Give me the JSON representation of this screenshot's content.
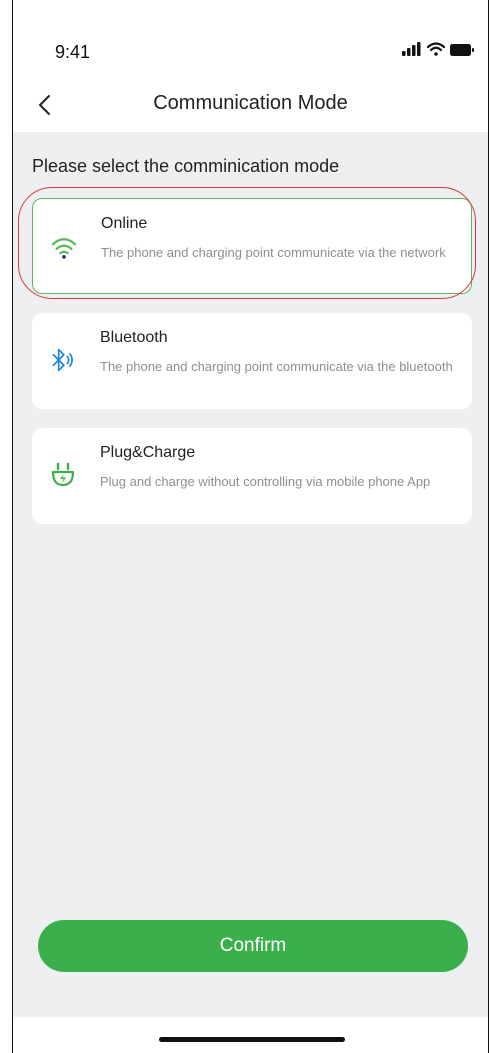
{
  "status_bar": {
    "time": "9:41"
  },
  "nav": {
    "title": "Communication Mode"
  },
  "section": {
    "label": "Please select the comminication mode"
  },
  "options": [
    {
      "title": "Online",
      "description": "The phone and charging point communicate via the network",
      "icon": "wifi-icon",
      "selected": true,
      "accent": "#5cb85c"
    },
    {
      "title": "Bluetooth",
      "description": "The phone and charging point communicate via the bluetooth",
      "icon": "bluetooth-icon",
      "selected": false,
      "accent": "#1e88e5"
    },
    {
      "title": "Plug&Charge",
      "description": "Plug and charge without controlling via mobile phone App",
      "icon": "plug-charge-icon",
      "selected": false,
      "accent": "#3aaf4b"
    }
  ],
  "confirm": {
    "label": "Confirm"
  },
  "colors": {
    "primary_green": "#3aaf4b",
    "selection_outline": "#5cb85c",
    "highlight_ring": "#d63a3a",
    "background": "#eeeff1"
  }
}
